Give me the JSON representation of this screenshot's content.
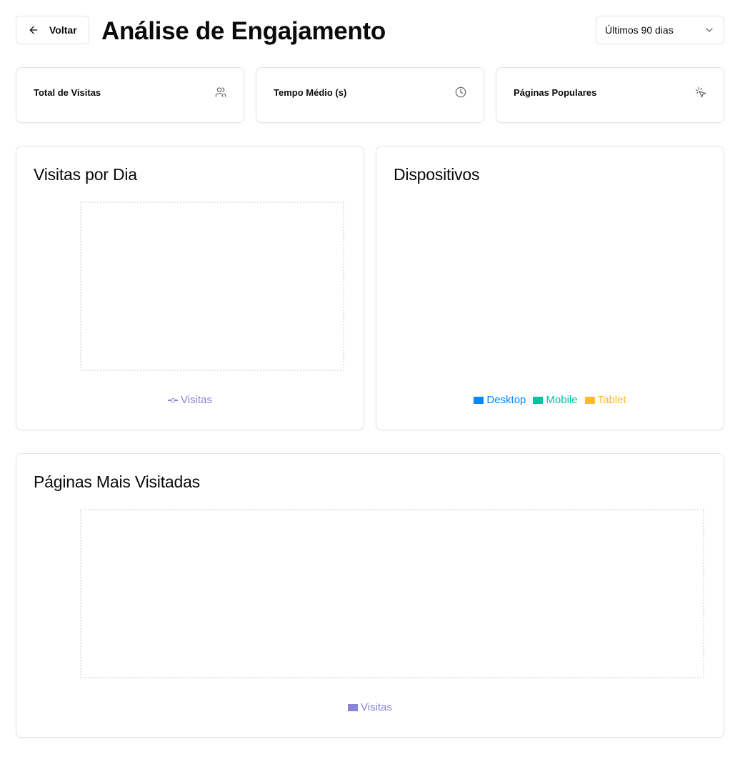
{
  "header": {
    "back_label": "Voltar",
    "title": "Análise de Engajamento",
    "range_selected": "Últimos 90 dias"
  },
  "stats": [
    {
      "label": "Total de Visitas",
      "icon": "users-icon"
    },
    {
      "label": "Tempo Médio (s)",
      "icon": "clock-icon"
    },
    {
      "label": "Páginas Populares",
      "icon": "pointer-click-icon"
    }
  ],
  "colors": {
    "visitas": "#8884d8",
    "desktop": "#0088FE",
    "mobile": "#00C49F",
    "tablet": "#FFBB28"
  },
  "charts": {
    "daily": {
      "title": "Visitas por Dia"
    },
    "devices": {
      "title": "Dispositivos"
    },
    "pages": {
      "title": "Páginas Mais Visitadas"
    }
  },
  "chart_data": [
    {
      "type": "line",
      "title": "Visitas por Dia",
      "series": [
        {
          "name": "Visitas",
          "values": []
        }
      ],
      "grid": true,
      "legend": "bottom"
    },
    {
      "type": "pie",
      "title": "Dispositivos",
      "categories": [
        "Desktop",
        "Mobile",
        "Tablet"
      ],
      "values": [],
      "legend": "bottom"
    },
    {
      "type": "bar",
      "title": "Páginas Mais Visitadas",
      "series": [
        {
          "name": "Visitas",
          "values": []
        }
      ],
      "grid": true,
      "legend": "bottom"
    }
  ]
}
